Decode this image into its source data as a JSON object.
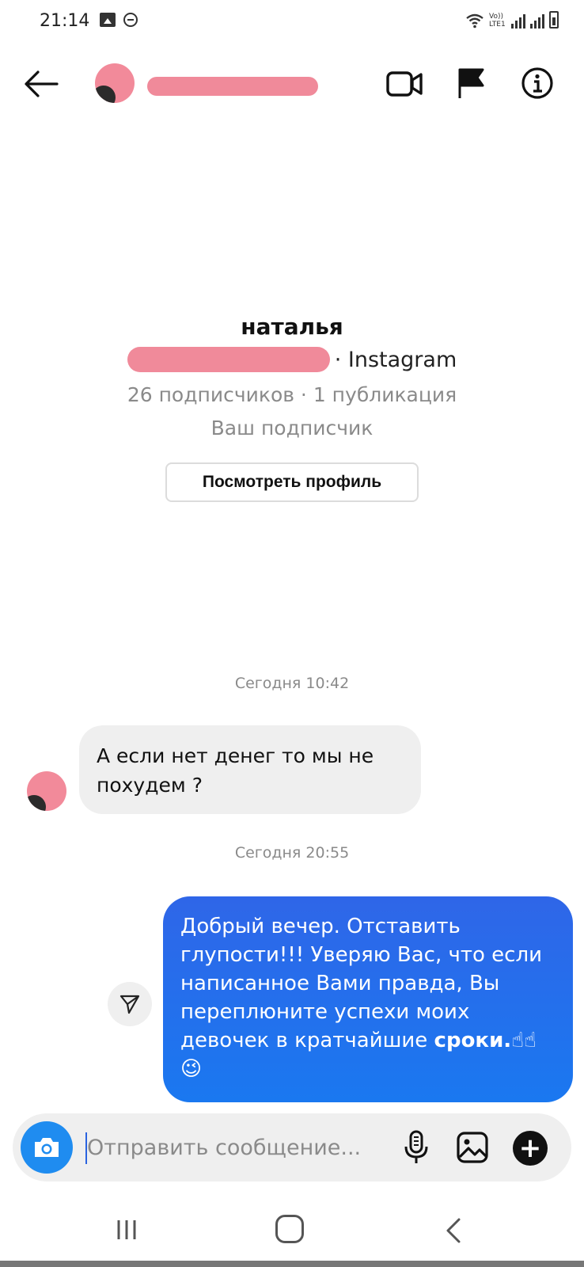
{
  "status_bar": {
    "time": "21:14",
    "network_label": "Vo)) LTE1"
  },
  "header": {
    "icons": [
      "back-arrow-icon",
      "video-call-icon",
      "flag-icon",
      "info-icon"
    ]
  },
  "profile": {
    "name": "наталья",
    "source_suffix": "· Instagram",
    "stats": "26 подписчиков · 1 публикация",
    "relation": "Ваш подписчик",
    "view_profile_label": "Посмотреть профиль"
  },
  "messages": [
    {
      "timestamp": "Сегодня 10:42",
      "direction": "incoming",
      "text": "А если нет денег то мы не похудем ?"
    },
    {
      "timestamp": "Сегодня 20:55",
      "direction": "outgoing",
      "text_before_bold": "Добрый вечер. Отставить глупости!!! Уверяю Вас, что если написанное Вами правда, Вы переплюните успехи моих девочек в кратчайшие ",
      "text_bold": "сроки.",
      "emoji": "☝☝😉"
    }
  ],
  "composer": {
    "placeholder": "Отправить сообщение...",
    "accent_color": "#1f8cf0"
  },
  "colors": {
    "outgoing_bubble": "#2f66e8",
    "incoming_bubble": "#efefef",
    "redaction": "#f08a9a"
  }
}
